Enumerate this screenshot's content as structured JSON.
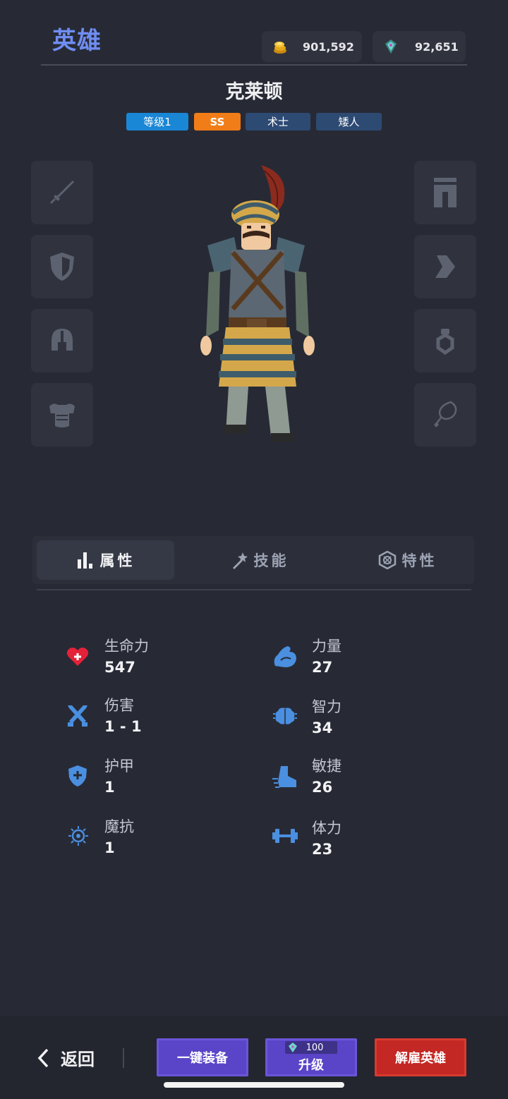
{
  "header": {
    "title": "英雄",
    "gold": {
      "icon": "gold-coins-icon",
      "value": "901,592"
    },
    "gems": {
      "icon": "gem-icon",
      "value": "92,651"
    }
  },
  "hero": {
    "name": "克莱顿",
    "tags": [
      {
        "label": "等级1",
        "color": "#1a86d6"
      },
      {
        "label": "SS",
        "color": "#f07d18"
      },
      {
        "label": "术士",
        "color": "#2d4a73"
      },
      {
        "label": "矮人",
        "color": "#2d4a73"
      }
    ]
  },
  "equipment": {
    "left": [
      "sword-icon",
      "shield-icon",
      "helmet-icon",
      "chest-armor-icon"
    ],
    "right": [
      "pants-icon",
      "boot-icon",
      "ring-icon",
      "amulet-icon"
    ]
  },
  "tabs": [
    {
      "label": "属性",
      "icon": "bar-chart-icon",
      "active": true
    },
    {
      "label": "技能",
      "icon": "magic-wand-icon",
      "active": false
    },
    {
      "label": "特性",
      "icon": "trait-badge-icon",
      "active": false
    }
  ],
  "stats": {
    "left": [
      {
        "label": "生命力",
        "value": "547",
        "icon": "heart-icon",
        "color": "#e5213a"
      },
      {
        "label": "伤害",
        "value": "1 - 1",
        "icon": "crossed-swords-icon",
        "color": "#4a8fe0"
      },
      {
        "label": "护甲",
        "value": "1",
        "icon": "armor-shield-icon",
        "color": "#4a8fe0"
      },
      {
        "label": "魔抗",
        "value": "1",
        "icon": "magic-resist-icon",
        "color": "#4a8fe0"
      }
    ],
    "right": [
      {
        "label": "力量",
        "value": "27",
        "icon": "muscle-icon",
        "color": "#4a8fe0"
      },
      {
        "label": "智力",
        "value": "34",
        "icon": "brain-icon",
        "color": "#4a8fe0"
      },
      {
        "label": "敏捷",
        "value": "26",
        "icon": "agility-boot-icon",
        "color": "#4a8fe0"
      },
      {
        "label": "体力",
        "value": "23",
        "icon": "dumbbell-icon",
        "color": "#4a8fe0"
      }
    ]
  },
  "footer": {
    "back_label": "返回",
    "equip_all_label": "一键装备",
    "upgrade_label": "升级",
    "upgrade_cost": "100",
    "dismiss_label": "解雇英雄"
  }
}
